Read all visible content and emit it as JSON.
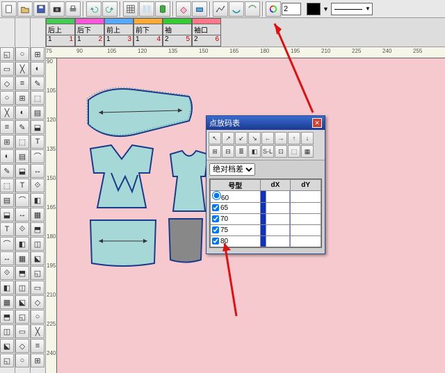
{
  "toolbar": {
    "num_value": "2"
  },
  "pieces": [
    {
      "bg": "#44cc55",
      "label": "后上",
      "n1": "1",
      "n2": "1"
    },
    {
      "bg": "#ff55dd",
      "label": "后下",
      "n1": "1",
      "n2": "2"
    },
    {
      "bg": "#55aaff",
      "label": "前上",
      "n1": "1",
      "n2": "3"
    },
    {
      "bg": "#ffaa33",
      "label": "前下",
      "n1": "1",
      "n2": "4"
    },
    {
      "bg": "#33cc33",
      "label": "袖",
      "n1": "2",
      "n2": "5"
    },
    {
      "bg": "#ff7788",
      "label": "袖口",
      "n1": "2",
      "n2": "6"
    }
  ],
  "ruler_h": [
    "75",
    "90",
    "105",
    "120",
    "135",
    "150",
    "165",
    "180",
    "195",
    "210",
    "225",
    "240",
    "255"
  ],
  "ruler_v": [
    "90",
    "105",
    "120",
    "135",
    "150",
    "165",
    "180",
    "195",
    "210",
    "225",
    "240"
  ],
  "dialog": {
    "title": "点放码表",
    "select_label": "绝对档差",
    "headers": [
      "号型",
      "dX",
      "dY"
    ],
    "rows": [
      {
        "size": "60",
        "radio": true
      },
      {
        "size": "65",
        "radio": false
      },
      {
        "size": "70",
        "radio": false
      },
      {
        "size": "75",
        "radio": false
      },
      {
        "size": "80",
        "radio": false
      }
    ],
    "tool_sl": "S-L"
  }
}
